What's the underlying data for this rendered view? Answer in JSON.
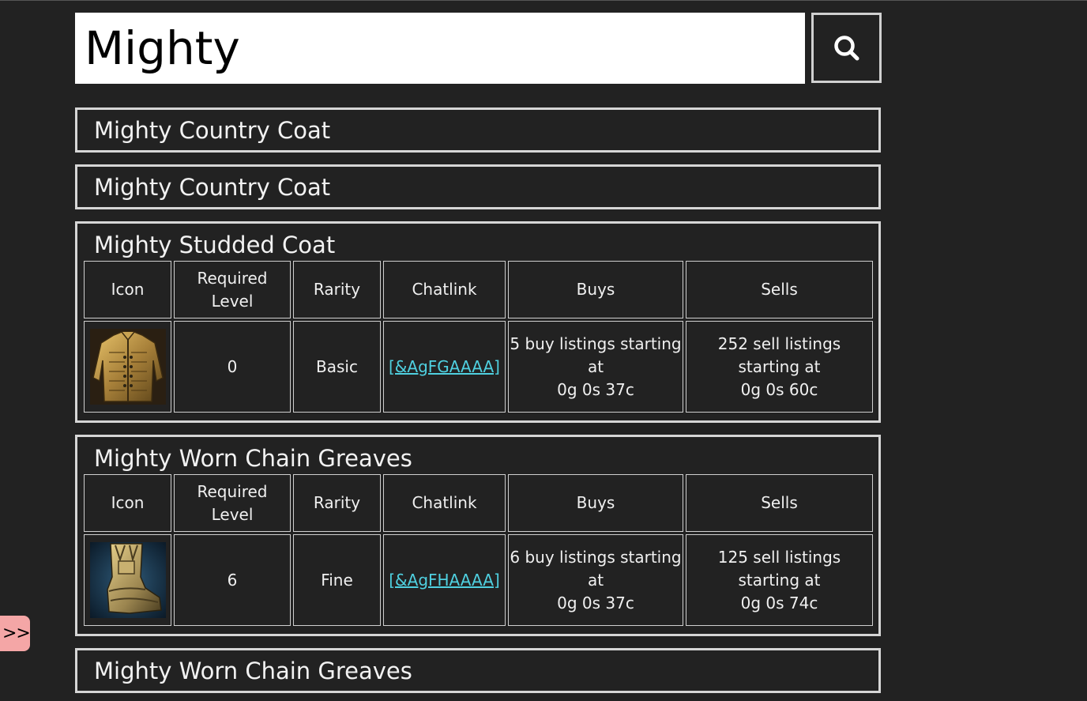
{
  "search": {
    "value": "Mighty",
    "button_icon": "search-icon"
  },
  "columns": [
    "Icon",
    "Required Level",
    "Rarity",
    "Chatlink",
    "Buys",
    "Sells"
  ],
  "results": [
    {
      "title": "Mighty Country Coat",
      "expanded": false
    },
    {
      "title": "Mighty Country Coat",
      "expanded": false
    },
    {
      "title": "Mighty Studded Coat",
      "expanded": true,
      "icon": "studded-coat-icon",
      "required_level": "0",
      "rarity": "Basic",
      "chatlink": "[&AgFGAAAA]",
      "buys_line1": "5 buy listings starting",
      "buys_line2": "at",
      "buys_line3": "0g 0s 37c",
      "sells_line1": "252 sell listings",
      "sells_line2": "starting at",
      "sells_line3": "0g 0s 60c"
    },
    {
      "title": "Mighty Worn Chain Greaves",
      "expanded": true,
      "icon": "chain-greaves-icon",
      "required_level": "6",
      "rarity": "Fine",
      "chatlink": "[&AgFHAAAA]",
      "buys_line1": "6 buy listings starting",
      "buys_line2": "at",
      "buys_line3": "0g 0s 37c",
      "sells_line1": "125 sell listings",
      "sells_line2": "starting at",
      "sells_line3": "0g 0s 74c"
    },
    {
      "title": "Mighty Worn Chain Greaves",
      "expanded": false
    }
  ],
  "sidebar_toggle": {
    "label": ">>"
  },
  "colors": {
    "background": "#222222",
    "border": "#d6d6d6",
    "link": "#4fd0e0",
    "toggle": "#f4a6a6"
  }
}
